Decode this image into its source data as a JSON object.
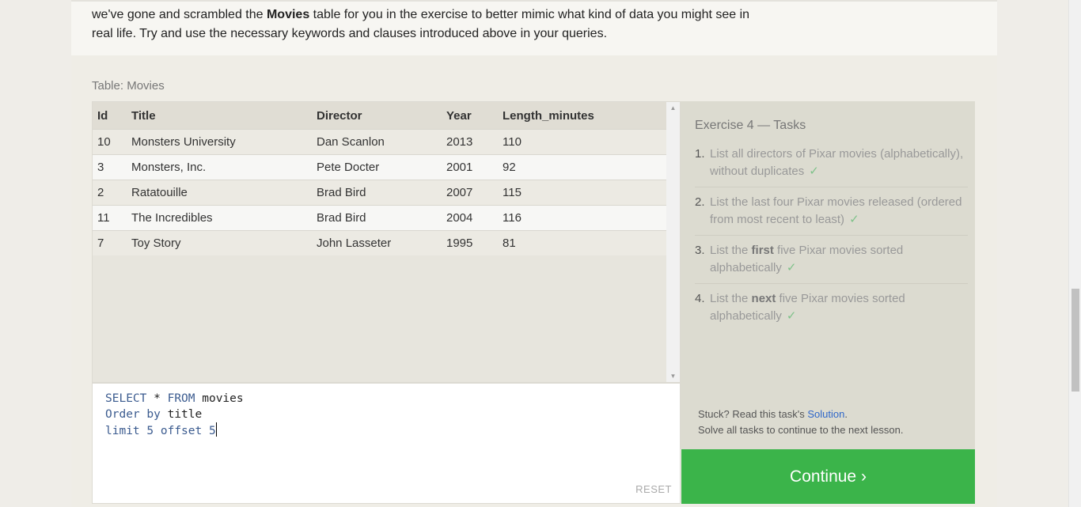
{
  "intro": {
    "part1": "we've gone and scrambled the ",
    "bold": "Movies",
    "part2": " table for you in the exercise to better mimic what kind of data you might see in real life. Try and use the necessary keywords and clauses introduced above in your queries."
  },
  "table": {
    "caption": "Table: Movies",
    "headers": [
      "Id",
      "Title",
      "Director",
      "Year",
      "Length_minutes"
    ],
    "rows": [
      [
        "10",
        "Monsters University",
        "Dan Scanlon",
        "2013",
        "110"
      ],
      [
        "3",
        "Monsters, Inc.",
        "Pete Docter",
        "2001",
        "92"
      ],
      [
        "2",
        "Ratatouille",
        "Brad Bird",
        "2007",
        "115"
      ],
      [
        "11",
        "The Incredibles",
        "Brad Bird",
        "2004",
        "116"
      ],
      [
        "7",
        "Toy Story",
        "John Lasseter",
        "1995",
        "81"
      ]
    ]
  },
  "editor": {
    "line1_kw1": "SELECT",
    "line1_op": " * ",
    "line1_kw2": "FROM",
    "line1_rest": " movies",
    "line2_kw1": "Order",
    "line2_kw2": " by",
    "line2_rest": " title",
    "line3_kw1": "limit",
    "line3_num1": " 5",
    "line3_kw2": " offset",
    "line3_num2": " 5",
    "reset_label": "RESET"
  },
  "tasks": {
    "title": "Exercise 4 — Tasks",
    "items": [
      {
        "num": "1.",
        "pre": "List all directors of Pixar movies (alphabetically), without duplicates",
        "bold": "",
        "post": "",
        "check": "✓"
      },
      {
        "num": "2.",
        "pre": "List the last four Pixar movies released (ordered from most recent to least)",
        "bold": "",
        "post": "",
        "check": "✓"
      },
      {
        "num": "3.",
        "pre": "List the ",
        "bold": "first",
        "post": " five Pixar movies sorted alphabetically",
        "check": "✓"
      },
      {
        "num": "4.",
        "pre": "List the ",
        "bold": "next",
        "post": " five Pixar movies sorted alphabetically",
        "check": "✓"
      }
    ],
    "stuck_pre": "Stuck? Read this task's ",
    "stuck_link": "Solution",
    "stuck_post": ".",
    "solve_note": "Solve all tasks to continue to the next lesson."
  },
  "continue_label": "Continue ›",
  "colors": {
    "continue": "#3bb44a",
    "link": "#2f67c9",
    "check": "#7fc28a"
  }
}
